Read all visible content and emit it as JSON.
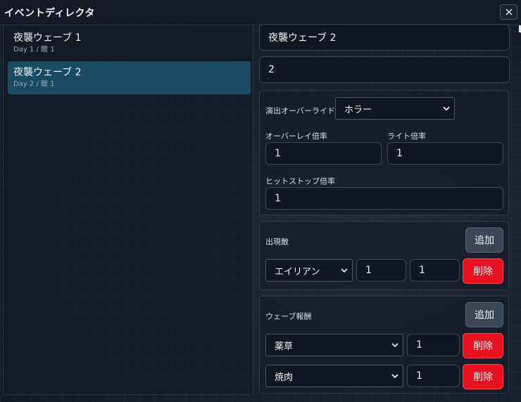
{
  "window": {
    "title": "イベントディレクタ",
    "close_icon": "close-icon"
  },
  "events": [
    {
      "name": "夜襲ウェーブ 1",
      "sub": "Day 1 / 敵 1",
      "selected": false
    },
    {
      "name": "夜襲ウェーブ 2",
      "sub": "Day 2 / 敵 1",
      "selected": true
    }
  ],
  "editor": {
    "name_value": "夜襲ウェーブ 2",
    "day_value": "2",
    "presentation": {
      "override_label": "演出オーバーライド",
      "override_value": "ホラー",
      "overlay_label": "オーバーレイ倍率",
      "overlay_value": "1",
      "light_label": "ライト倍率",
      "light_value": "1",
      "hitstop_label": "ヒットストップ倍率",
      "hitstop_value": "1"
    },
    "enemies": {
      "label": "出現敵",
      "add_label": "追加",
      "rows": [
        {
          "type": "エイリアン",
          "count": "1",
          "extra": "1",
          "delete_label": "削除"
        }
      ]
    },
    "rewards": {
      "label": "ウェーブ報酬",
      "add_label": "追加",
      "rows": [
        {
          "item": "薬草",
          "qty": "1",
          "delete_label": "削除"
        },
        {
          "item": "焼肉",
          "qty": "1",
          "delete_label": "削除"
        }
      ]
    }
  },
  "colors": {
    "background": "#1a2230",
    "selected_item": "#1b4a63",
    "add_button": "#3b4656",
    "delete_button": "#e8101e"
  }
}
